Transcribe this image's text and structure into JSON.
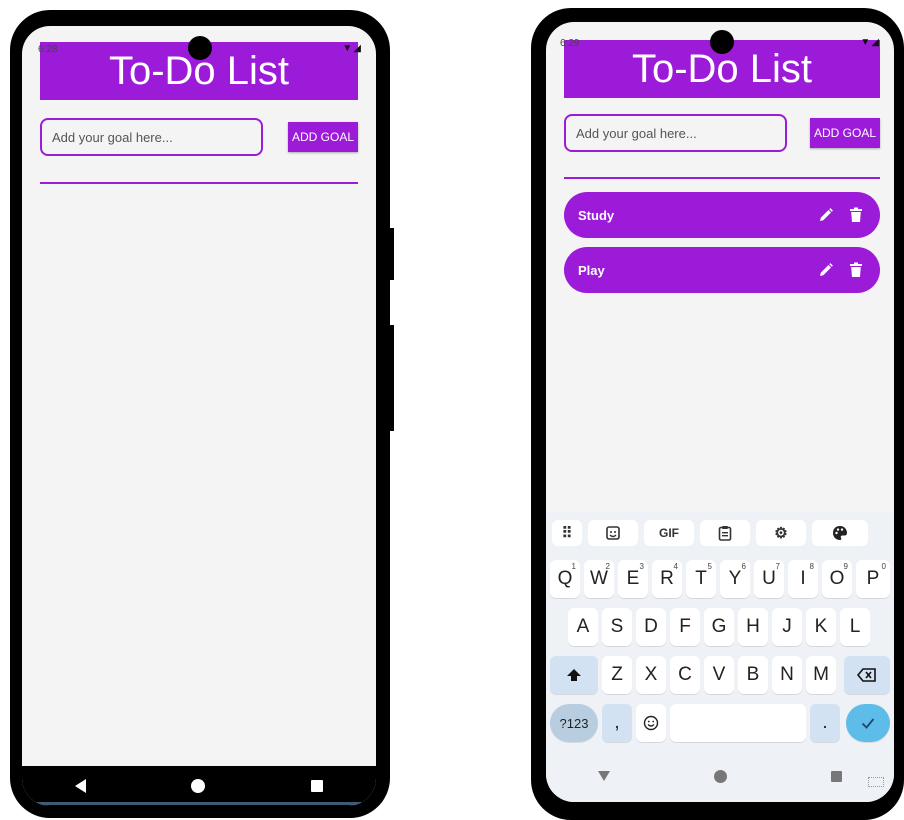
{
  "phone_left": {
    "status_time": "6:28",
    "title": "To-Do List",
    "input_placeholder": "Add your goal here...",
    "add_button_label": "ADD GOAL"
  },
  "phone_right": {
    "status_time": "6:29",
    "title": "To-Do List",
    "input_placeholder": "Add your goal here...",
    "add_button_label": "ADD GOAL",
    "goals": [
      {
        "label": "Study"
      },
      {
        "label": "Play"
      }
    ],
    "keyboard": {
      "toolbar": [
        "apps-grid-icon",
        "sticker-icon",
        "GIF",
        "clipboard-icon",
        "settings-icon",
        "palette-icon"
      ],
      "gif_label": "GIF",
      "row1": [
        "Q",
        "W",
        "E",
        "R",
        "T",
        "Y",
        "U",
        "I",
        "O",
        "P"
      ],
      "row1_hints": [
        "1",
        "2",
        "3",
        "4",
        "5",
        "6",
        "7",
        "8",
        "9",
        "0"
      ],
      "row2": [
        "A",
        "S",
        "D",
        "F",
        "G",
        "H",
        "J",
        "K",
        "L"
      ],
      "row3": [
        "Z",
        "X",
        "C",
        "V",
        "B",
        "N",
        "M"
      ],
      "symbols_key": "?123",
      "comma_key": ",",
      "period_key": "."
    }
  },
  "colors": {
    "accent": "#9c1bd8",
    "screen_bg": "#f4f4f4",
    "enter_key": "#5ebce9"
  }
}
